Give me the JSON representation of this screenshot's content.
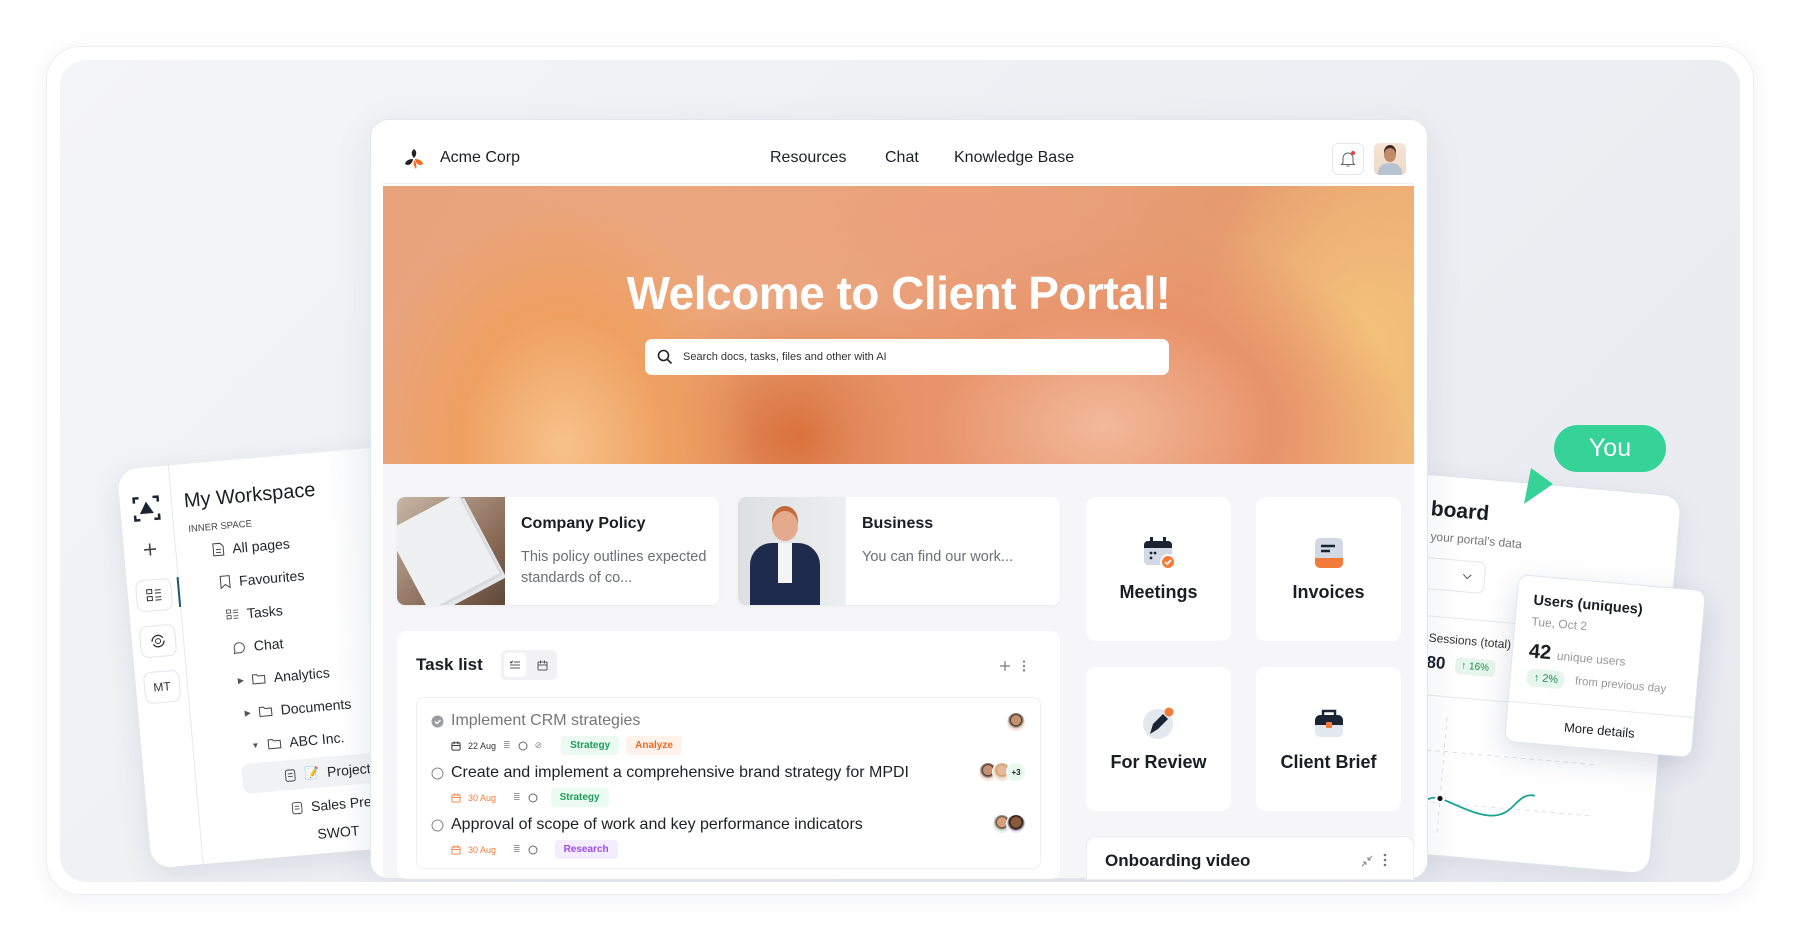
{
  "colors": {
    "accent": "#f47b3a",
    "presence": "#36d399",
    "strategy": "#1c9e5a",
    "analyze": "#ea6a22",
    "research": "#9b4ee6"
  },
  "sidebar": {
    "title": "My Workspace",
    "section": "INNER SPACE",
    "rail": {
      "initials": "MT",
      "icons": [
        "workspace-logo-icon",
        "plus-icon",
        "tasks-icon",
        "sync-icon"
      ]
    },
    "items": [
      {
        "label": "All pages",
        "icon": "page-icon"
      },
      {
        "label": "Favourites",
        "icon": "bookmark-icon"
      },
      {
        "label": "Tasks",
        "icon": "tasks-icon"
      },
      {
        "label": "Chat",
        "icon": "chat-icon"
      },
      {
        "label": "Analytics",
        "icon": "folder-icon",
        "expanded": false
      },
      {
        "label": "Documents",
        "icon": "folder-icon",
        "expanded": false
      },
      {
        "label": "ABC Inc.",
        "icon": "folder-icon",
        "expanded": true
      },
      {
        "label": "Project Pl",
        "icon": "page-icon",
        "emoji": "📝",
        "selected": true
      },
      {
        "label": "Sales Prese",
        "icon": "page-icon"
      },
      {
        "label": "SWOT"
      }
    ]
  },
  "header": {
    "brand": "Acme Corp",
    "nav": [
      "Resources",
      "Chat",
      "Knowledge Base"
    ],
    "notifications": {
      "icon": "bell-icon",
      "unread": true
    }
  },
  "hero": {
    "title": "Welcome to Client Portal!",
    "search_placeholder": "Search docs, tasks, files and other with AI"
  },
  "docs": [
    {
      "title": "Company Policy",
      "desc": "This policy outlines expected standards of co..."
    },
    {
      "title": "Business",
      "desc": "You can find our work..."
    }
  ],
  "tiles": [
    {
      "label": "Meetings",
      "icon": "calendar-check-icon"
    },
    {
      "label": "Invoices",
      "icon": "invoice-icon"
    },
    {
      "label": "For Review",
      "icon": "pen-icon"
    },
    {
      "label": "Client Brief",
      "icon": "briefcase-icon"
    }
  ],
  "onboarding": {
    "title": "Onboarding video"
  },
  "tasks": {
    "title": "Task list",
    "views": [
      "list",
      "calendar"
    ],
    "items": [
      {
        "title": "Implement CRM strategies",
        "done": true,
        "date": "22 Aug",
        "overdue": false,
        "tags": [
          {
            "label": "Strategy",
            "tone": "g"
          },
          {
            "label": "Analyze",
            "tone": "o"
          }
        ],
        "attachment": true,
        "extra": ""
      },
      {
        "title": "Create and implement a comprehensive brand strategy for MPDI",
        "done": false,
        "date": "30 Aug",
        "overdue": true,
        "tags": [
          {
            "label": "Strategy",
            "tone": "g"
          }
        ],
        "attachment": false,
        "extra": "+3"
      },
      {
        "title": "Approval of scope of work and key performance indicators",
        "done": false,
        "date": "30 Aug",
        "overdue": true,
        "tags": [
          {
            "label": "Research",
            "tone": "p"
          }
        ],
        "attachment": false,
        "extra": ""
      }
    ]
  },
  "dashboard": {
    "title_visible": "board",
    "subtitle_visible": "your portal's data",
    "sessions": {
      "label": "Sessions (total)",
      "value": "80",
      "change": "↑ 16%"
    },
    "tooltip": {
      "title": "Users (uniques)",
      "date": "Tue, Oct 2",
      "value": "42",
      "unit": "unique users",
      "change": "↑ 2%",
      "change_label": "from previous day",
      "link": "More details"
    }
  },
  "presence": {
    "label": "You"
  }
}
